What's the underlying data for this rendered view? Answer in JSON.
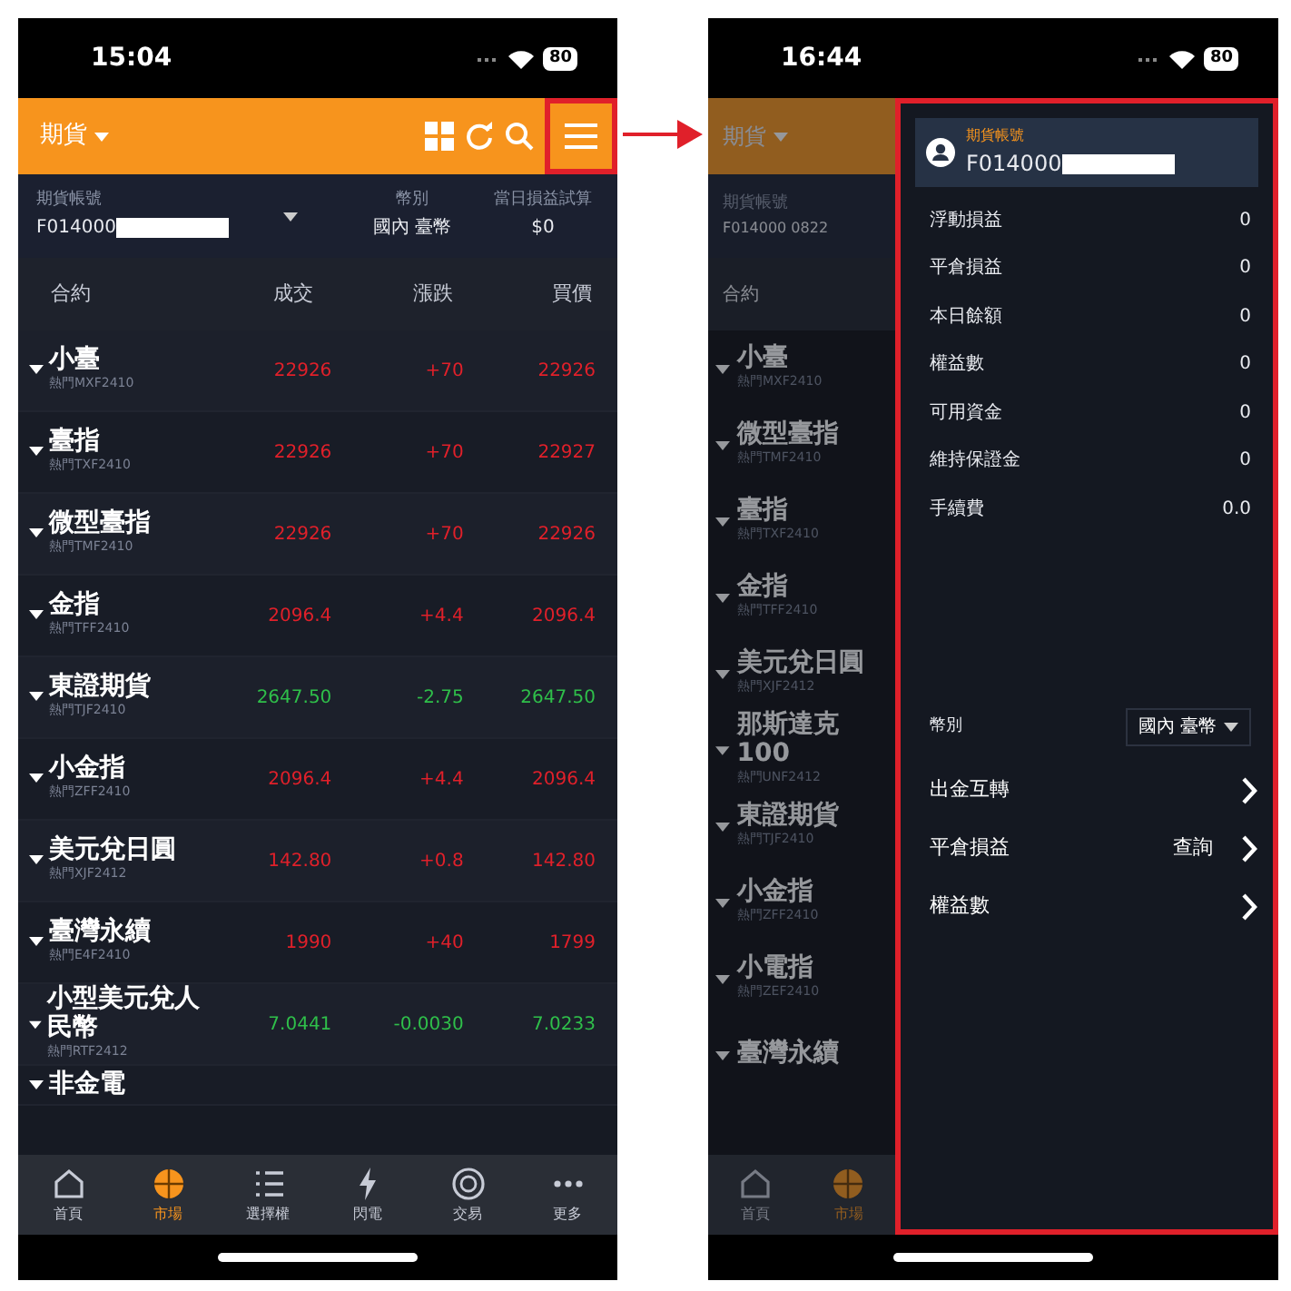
{
  "left_screen": {
    "status_bar": {
      "time": "15:04",
      "battery": "80"
    },
    "header": {
      "market_menu": "期貨",
      "menu_highlighted": true
    },
    "account": {
      "label": "期貨帳號",
      "number": "F014000"
    },
    "currency": {
      "label": "幣別",
      "value": "國內 臺幣"
    },
    "pnl": {
      "label": "當日損益試算",
      "value": "$0"
    },
    "table": {
      "columns": [
        "合約",
        "成交",
        "漲跌",
        "買價"
      ],
      "rows": [
        {
          "name": "小臺",
          "code": "熱門MXF2410",
          "trade": "22926",
          "change": "+70",
          "bid": "22926",
          "color": "#e0202a"
        },
        {
          "name": "臺指",
          "code": "熱門TXF2410",
          "trade": "22926",
          "change": "+70",
          "bid": "22927",
          "color": "#e0202a"
        },
        {
          "name": "微型臺指",
          "code": "熱門TMF2410",
          "trade": "22926",
          "change": "+70",
          "bid": "22926",
          "color": "#e0202a"
        },
        {
          "name": "金指",
          "code": "熱門TFF2410",
          "trade": "2096.4",
          "change": "+4.4",
          "bid": "2096.4",
          "color": "#e0202a"
        },
        {
          "name": "東證期貨",
          "code": "熱門TJF2410",
          "trade": "2647.50",
          "change": "-2.75",
          "bid": "2647.50",
          "color": "#2fbf4a"
        },
        {
          "name": "小金指",
          "code": "熱門ZFF2410",
          "trade": "2096.4",
          "change": "+4.4",
          "bid": "2096.4",
          "color": "#e0202a"
        },
        {
          "name": "美元兌日圓",
          "code": "熱門XJF2412",
          "trade": "142.80",
          "change": "+0.8",
          "bid": "142.80",
          "color": "#e0202a"
        },
        {
          "name": "臺灣永續",
          "code": "熱門E4F2410",
          "trade": "1990",
          "change": "+40",
          "bid": "1799",
          "color": "#e0202a"
        },
        {
          "name": "小型美元兌人民幣",
          "code": "熱門RTF2412",
          "trade": "7.0441",
          "change": "-0.0030",
          "bid": "7.0233",
          "color": "#2fbf4a"
        },
        {
          "name": "非金電"
        }
      ]
    },
    "tab_bar": [
      {
        "label": "首頁",
        "selected": false
      },
      {
        "label": "市場",
        "selected": true
      },
      {
        "label": "選擇權",
        "selected": false
      },
      {
        "label": "閃電",
        "selected": false
      },
      {
        "label": "交易",
        "selected": false
      },
      {
        "label": "更多",
        "selected": false
      }
    ]
  },
  "right_screen": {
    "status_bar": {
      "time": "16:44",
      "battery": "80"
    },
    "background": {
      "market_menu": "期貨",
      "account_label": "期貨帳號",
      "account_number": "F014000 0822",
      "column": "合約",
      "rows": [
        {
          "name": "小臺",
          "code": "熱門MXF2410"
        },
        {
          "name": "微型臺指",
          "code": "熱門TMF2410"
        },
        {
          "name": "臺指",
          "code": "熱門TXF2410"
        },
        {
          "name": "金指",
          "code": "熱門TFF2410"
        },
        {
          "name": "美元兌日圓",
          "code": "熱門XJF2412"
        },
        {
          "name": "那斯達克 100",
          "code": "熱門UNF2412"
        },
        {
          "name": "東證期貨",
          "code": "熱門TJF2410"
        },
        {
          "name": "小金指",
          "code": "熱門ZFF2410"
        },
        {
          "name": "小電指",
          "code": "熱門ZEF2410"
        },
        {
          "name": "臺灣永續"
        }
      ],
      "tab_bar": [
        {
          "label": "首頁",
          "selected": false
        },
        {
          "label": "市場",
          "selected": true
        }
      ]
    },
    "drawer": {
      "highlighted": true,
      "account_label": "期貨帳號",
      "account_number": "F014000",
      "balances": [
        {
          "label": "浮動損益",
          "value": "0"
        },
        {
          "label": "平倉損益",
          "value": "0"
        },
        {
          "label": "本日餘額",
          "value": "0"
        },
        {
          "label": "權益數",
          "value": "0"
        },
        {
          "label": "可用資金",
          "value": "0"
        },
        {
          "label": "維持保證金",
          "value": "0"
        },
        {
          "label": "手續費",
          "value": "0.0"
        }
      ],
      "currency": {
        "label": "幣別",
        "value": "國內 臺幣"
      },
      "links": [
        {
          "label": "出金互轉"
        },
        {
          "label": "平倉損益",
          "value": "查詢"
        },
        {
          "label": "權益數"
        }
      ]
    }
  }
}
